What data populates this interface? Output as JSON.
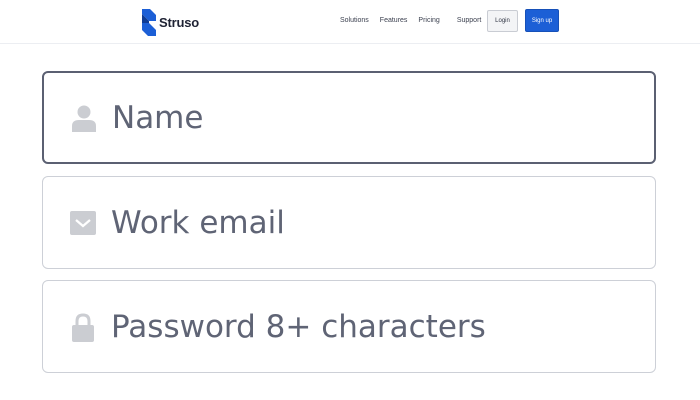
{
  "brand": {
    "name": "Struso",
    "color": "#1c5fd6"
  },
  "nav": {
    "links": [
      "Solutions",
      "Features",
      "Pricing",
      "Support"
    ],
    "login_label": "Login",
    "signup_label": "Sign up"
  },
  "form": {
    "name_placeholder": "Name",
    "email_placeholder": "Work email",
    "password_placeholder": "Password 8+ characters",
    "icons": [
      "user-icon",
      "mail-icon",
      "lock-icon"
    ],
    "focused_field": "name"
  }
}
